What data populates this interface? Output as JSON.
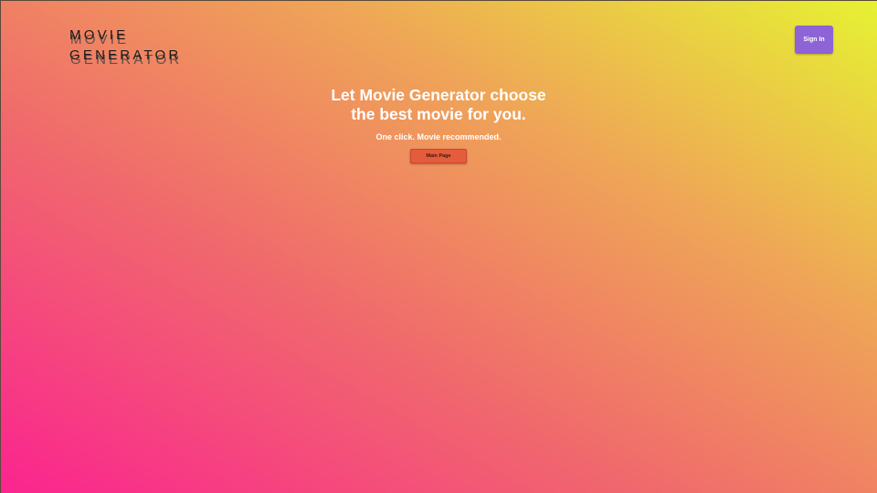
{
  "header": {
    "logo_line1": "MOVIE",
    "logo_line2": "GENERATOR",
    "signin_label": "Sign In"
  },
  "hero": {
    "title_line1": "Let Movie Generator choose",
    "title_line2": "the best movie for you.",
    "subtitle": "One click. Movie recommended.",
    "main_button_label": "Main Page"
  },
  "colors": {
    "gradient_bottom_left": "#fb248f",
    "gradient_top_right": "#e6f232",
    "signin_button": "#8d63d6",
    "main_button": "#e55c3c"
  }
}
